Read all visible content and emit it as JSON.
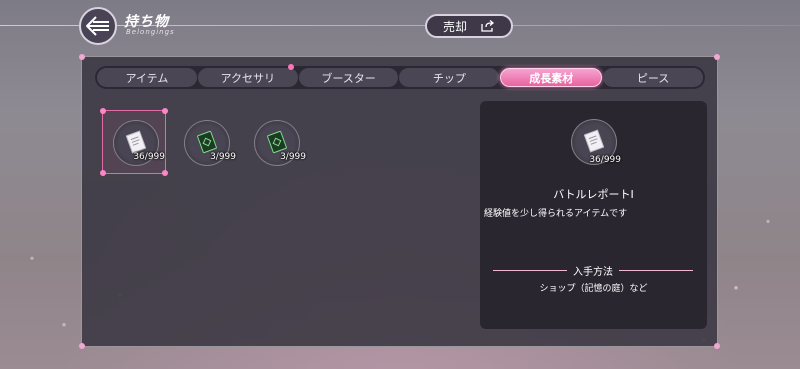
{
  "header": {
    "title": "持ち物",
    "subtitle": "Belongings",
    "sell_label": "売却",
    "back_icon": "arrow-left-icon",
    "sell_icon": "export-icon"
  },
  "tabs": [
    {
      "label": "アイテム",
      "active": false,
      "badge": false
    },
    {
      "label": "アクセサリ",
      "active": false,
      "badge": true
    },
    {
      "label": "ブースター",
      "active": false,
      "badge": false
    },
    {
      "label": "チップ",
      "active": false,
      "badge": false
    },
    {
      "label": "成長素材",
      "active": true,
      "badge": false
    },
    {
      "label": "ピース",
      "active": false,
      "badge": false
    }
  ],
  "items": [
    {
      "icon": "report-document-icon",
      "count": "36/999",
      "selected": true
    },
    {
      "icon": "green-chip-card-icon",
      "count": "3/999",
      "selected": false
    },
    {
      "icon": "green-chip-card-icon",
      "count": "3/999",
      "selected": false
    }
  ],
  "detail": {
    "icon": "report-document-icon",
    "count": "36/999",
    "name": "バトルレポートⅠ",
    "description": "経験値を少し得られるアイテムです",
    "acquisition_header": "入手方法",
    "acquisition_text": "ショップ（記憶の庭）など"
  },
  "colors": {
    "accent_pink": "#e9639f",
    "panel_dark": "#2a2630"
  }
}
